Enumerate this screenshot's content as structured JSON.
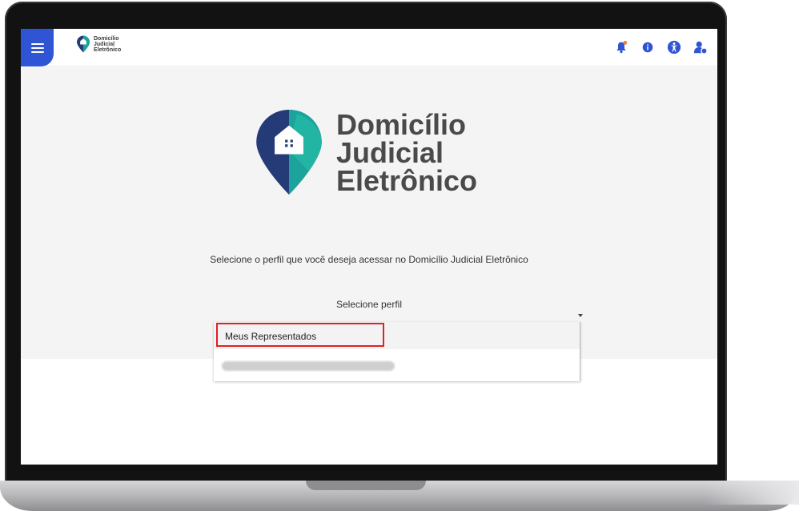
{
  "header": {
    "logo_lines": [
      "Domicílio",
      "Judicial",
      "Eletrônico"
    ],
    "icons": [
      "menu-icon",
      "bell-icon",
      "info-icon",
      "accessibility-icon",
      "user-icon"
    ]
  },
  "brand": {
    "line1": "Domicílio",
    "line2": "Judicial",
    "line3": "Eletrônico"
  },
  "main": {
    "prompt": "Selecione o perfil que você deseja acessar no Domicílio Judicial Eletrônico",
    "select_label": "Selecione perfil",
    "options": [
      "Meus Representados"
    ]
  },
  "colors": {
    "primary": "#2f55d4",
    "brand_teal": "#1ba39c",
    "brand_navy": "#243b78",
    "highlight": "#e01f26",
    "notification": "#f07d2a"
  }
}
